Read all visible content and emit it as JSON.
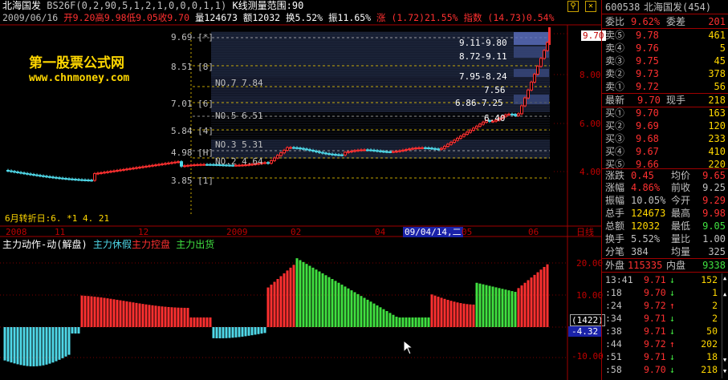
{
  "header": {
    "title": "北海国发",
    "formula": "BS26F(0,2,90,5,1,2,1,0,0,0,1,1)",
    "range_label": "K线测量范围:90",
    "date": "2009/06/16",
    "open": "开9.20",
    "high": "高9.98",
    "low": "低9.05",
    "close": "收9.70",
    "volume": "量124673",
    "amount": "额12032",
    "turnover": "换5.52%",
    "amplitude": "振11.65%",
    "change": "涨 (1.72)21.55%",
    "index": "指数 (14.73)0.54%"
  },
  "watermark": {
    "site": "第一股票公式网",
    "url": "www.chnmoney.com"
  },
  "chart": {
    "levels": [
      {
        "label": "9.69",
        "tag": "[*]"
      },
      {
        "label": "8.51",
        "tag": "[8]"
      },
      {
        "label": "7.01",
        "tag": "[6]"
      },
      {
        "label": "5.84",
        "tag": "[4]"
      },
      {
        "label": "4.98",
        "tag": "[H]"
      },
      {
        "label": "3.85",
        "tag": "[1]"
      }
    ],
    "no_labels": [
      "NO.7 7.84",
      "NO.5 6.51",
      "NO.3 5.31",
      "NO.2 4.64"
    ],
    "range_boxes": [
      "9.11-9.80",
      "8.72-9.11",
      "7.95-8.24",
      "7.56",
      "6.86-7.25",
      "6.40"
    ],
    "turn_info": "6月转折日:6. *1 4. 21",
    "price_axis": [
      "9.70",
      "8.00",
      "6.00",
      "4.00"
    ],
    "time_axis": [
      "2008",
      "11",
      "12",
      "2009",
      "02",
      "04",
      "05",
      "06",
      "日线"
    ],
    "cursor_date": "09/04/14,二"
  },
  "indicator": {
    "title": "主力动作-动(解盘)",
    "legend_1": "主力休假",
    "legend_2": "主力控盘",
    "legend_3": "主力出货",
    "axis": [
      "20.00",
      "10.00",
      "-10.00"
    ],
    "value_box": "(1422)",
    "value": "-4.32"
  },
  "quote_panel": {
    "code": "600538",
    "name": "北海国发(454)",
    "ratio_label": "委比",
    "ratio": "9.62%",
    "diff_label": "委差",
    "diff": "201",
    "asks": [
      {
        "label": "卖⑤",
        "price": "9.78",
        "vol": "461"
      },
      {
        "label": "卖④",
        "price": "9.76",
        "vol": "5"
      },
      {
        "label": "卖③",
        "price": "9.75",
        "vol": "45"
      },
      {
        "label": "卖②",
        "price": "9.73",
        "vol": "378"
      },
      {
        "label": "卖①",
        "price": "9.72",
        "vol": "56"
      }
    ],
    "last_label": "最新",
    "last": "9.70",
    "hand_label": "现手",
    "hand": "218",
    "bids": [
      {
        "label": "买①",
        "price": "9.70",
        "vol": "163"
      },
      {
        "label": "买②",
        "price": "9.69",
        "vol": "120"
      },
      {
        "label": "买③",
        "price": "9.68",
        "vol": "233"
      },
      {
        "label": "买④",
        "price": "9.67",
        "vol": "410"
      },
      {
        "label": "买⑤",
        "price": "9.66",
        "vol": "220"
      }
    ],
    "stats": [
      {
        "k1": "涨跌",
        "v1": "0.45",
        "k2": "均价",
        "v2": "9.65"
      },
      {
        "k1": "涨幅",
        "v1": "4.86%",
        "k2": "前收",
        "v2": "9.25"
      },
      {
        "k1": "振幅",
        "v1": "10.05%",
        "k2": "今开",
        "v2": "9.29"
      },
      {
        "k1": "总手",
        "v1": "124673",
        "k2": "最高",
        "v2": "9.98"
      },
      {
        "k1": "总额",
        "v1": "12032",
        "k2": "最低",
        "v2": "9.05"
      },
      {
        "k1": "换手",
        "v1": "5.52%",
        "k2": "量比",
        "v2": "1.00"
      },
      {
        "k1": "分笔",
        "v1": "384",
        "k2": "均量",
        "v2": "325"
      }
    ],
    "outer_label": "外盘",
    "outer": "115335",
    "inner_label": "内盘",
    "inner": "9338",
    "ticks": [
      {
        "time": "13:41",
        "price": "9.71",
        "dir": "↓",
        "vol": "152"
      },
      {
        "time": ":18",
        "price": "9.70",
        "dir": "↓",
        "vol": "1"
      },
      {
        "time": ":24",
        "price": "9.72",
        "dir": "↑",
        "vol": "2"
      },
      {
        "time": ":34",
        "price": "9.71",
        "dir": "↓",
        "vol": "2"
      },
      {
        "time": ":38",
        "price": "9.71",
        "dir": "↓",
        "vol": "50"
      },
      {
        "time": ":44",
        "price": "9.72",
        "dir": "↑",
        "vol": "202"
      },
      {
        "time": ":51",
        "price": "9.71",
        "dir": "↓",
        "vol": "18"
      },
      {
        "time": ":58",
        "price": "9.70",
        "dir": "↓",
        "vol": "218"
      }
    ]
  }
}
